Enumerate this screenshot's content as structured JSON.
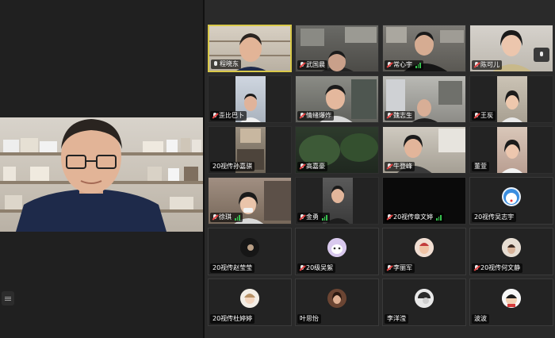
{
  "speaker": {
    "name_label": ""
  },
  "colors": {
    "active_border": "#d9c94a",
    "signal": "#36c14e",
    "muted": "#e64545"
  },
  "tiles": [
    {
      "name": "程晓东",
      "muted": false,
      "signal": false,
      "active": true
    },
    {
      "name": "武国晨",
      "muted": true,
      "signal": false,
      "active": false
    },
    {
      "name": "常心宇",
      "muted": true,
      "signal": true,
      "active": false
    },
    {
      "name": "陈可儿",
      "muted": true,
      "signal": false,
      "active": false
    },
    {
      "name": "歪比巴卜",
      "muted": true,
      "signal": false,
      "active": false
    },
    {
      "name": "情绪爆炸",
      "muted": true,
      "signal": false,
      "active": false
    },
    {
      "name": "魏志生",
      "muted": true,
      "signal": false,
      "active": false
    },
    {
      "name": "王炭",
      "muted": true,
      "signal": false,
      "active": false
    },
    {
      "name": "20视传孙嘉骐",
      "muted": false,
      "signal": false,
      "active": false
    },
    {
      "name": "高嘉豪",
      "muted": true,
      "signal": false,
      "active": false
    },
    {
      "name": "牛登峰",
      "muted": true,
      "signal": false,
      "active": false
    },
    {
      "name": "董萱",
      "muted": false,
      "signal": false,
      "active": false
    },
    {
      "name": "徐琪",
      "muted": true,
      "signal": true,
      "active": false
    },
    {
      "name": "金勇",
      "muted": true,
      "signal": true,
      "active": false
    },
    {
      "name": "20视传章文婷",
      "muted": true,
      "signal": true,
      "active": false
    },
    {
      "name": "20视传吴志宇",
      "muted": false,
      "signal": false,
      "active": false
    },
    {
      "name": "20视传赵莹莹",
      "muted": false,
      "signal": false,
      "active": false
    },
    {
      "name": "20级吴絮",
      "muted": true,
      "signal": false,
      "active": false
    },
    {
      "name": "李丽军",
      "muted": true,
      "signal": false,
      "active": false
    },
    {
      "name": "20视传何文静",
      "muted": true,
      "signal": false,
      "active": false
    },
    {
      "name": "20视传杜婷婷",
      "muted": false,
      "signal": false,
      "active": false
    },
    {
      "name": "叶思怡",
      "muted": false,
      "signal": false,
      "active": false
    },
    {
      "name": "李洋滢",
      "muted": false,
      "signal": false,
      "active": false
    },
    {
      "name": "波波",
      "muted": false,
      "signal": false,
      "active": false
    }
  ]
}
